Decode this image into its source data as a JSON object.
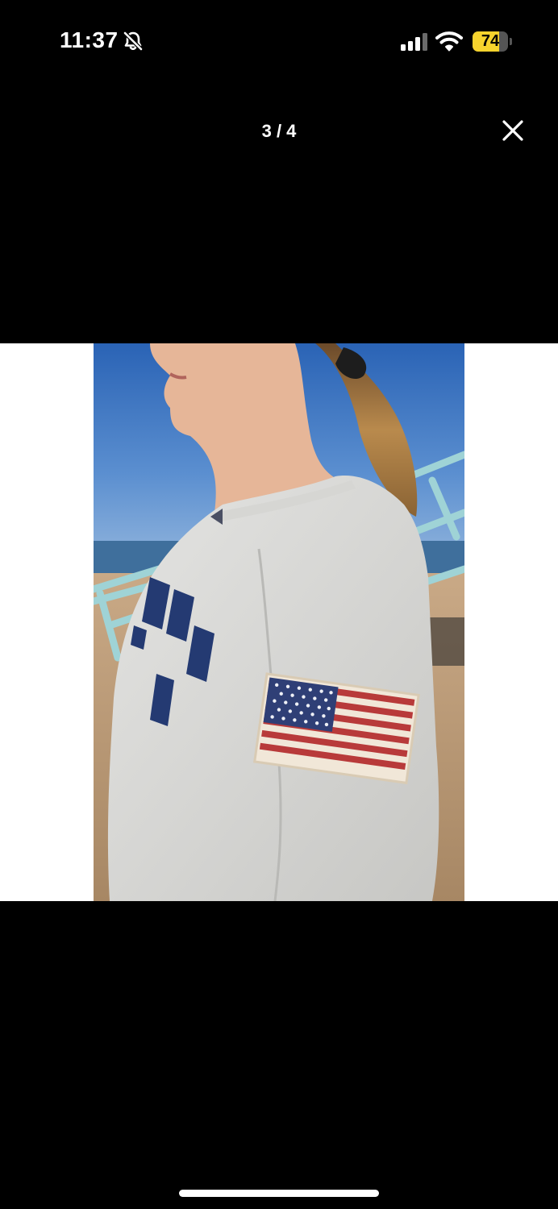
{
  "status_bar": {
    "time": "11:37",
    "silent_mode_icon": "bell-slash-icon",
    "signal_icon": "cellular-signal-icon",
    "wifi_icon": "wifi-icon",
    "battery_level": "74",
    "battery_fraction": 0.74,
    "battery_color": "#f6d32d"
  },
  "viewer": {
    "page_indicator": "3 / 4",
    "close_icon": "close-icon",
    "current_page": 3,
    "total_pages": 4
  },
  "photo": {
    "subject": "product-photo",
    "background_color": "#ffffff"
  }
}
